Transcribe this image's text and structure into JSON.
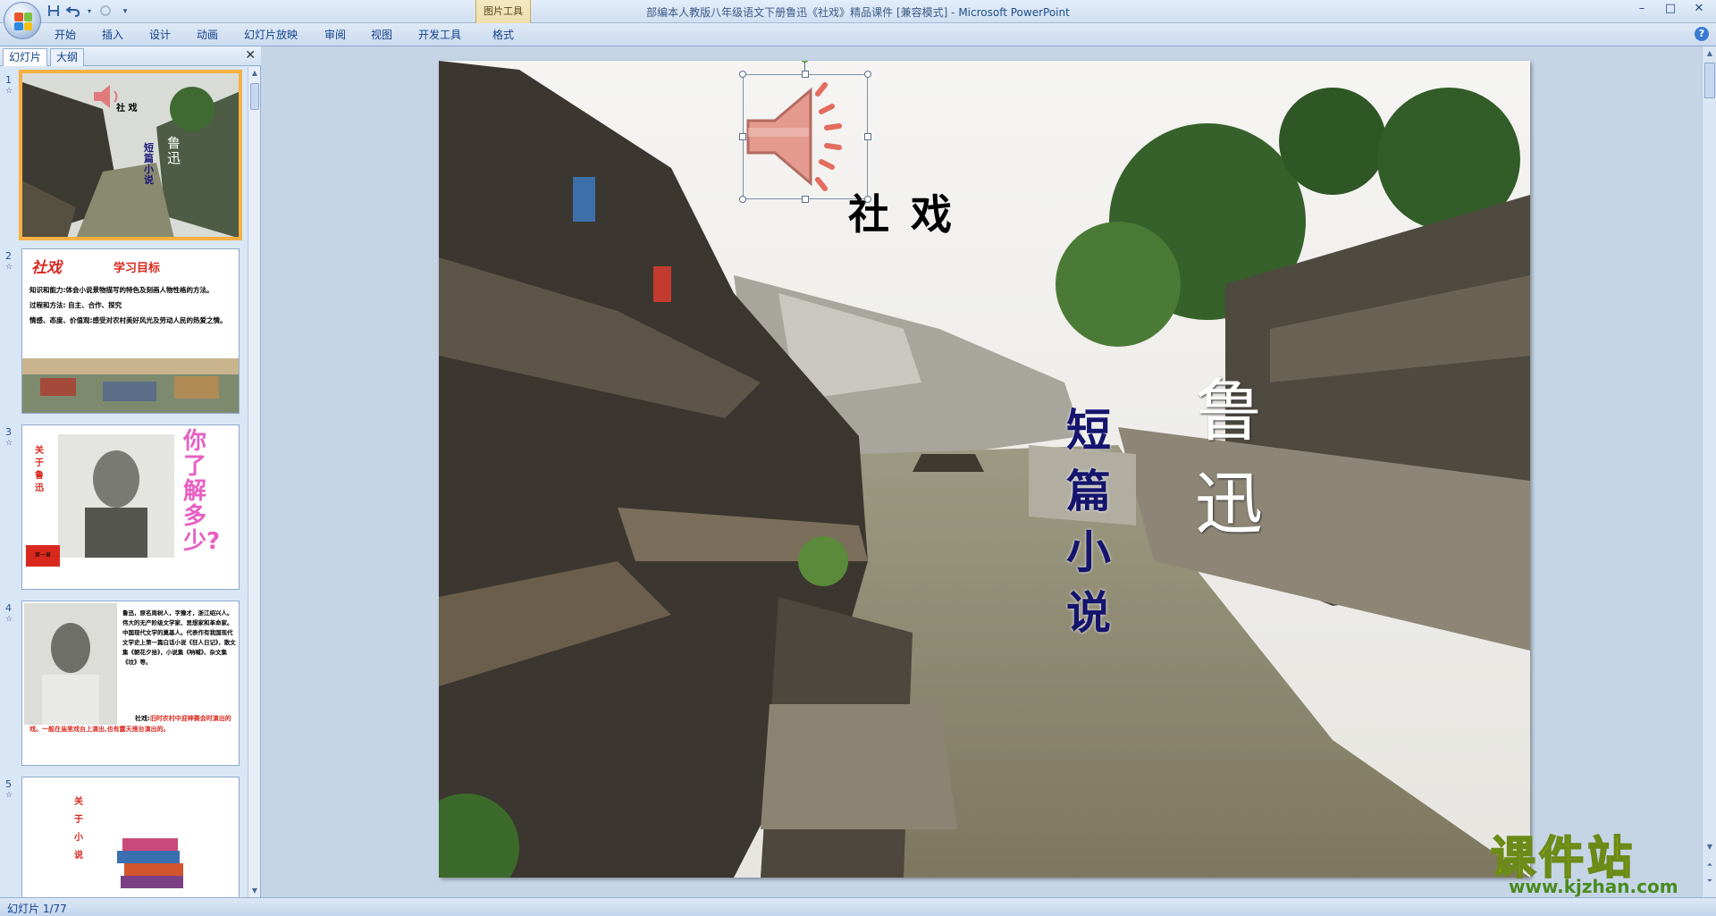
{
  "window": {
    "title_prefix": "部编本人教版八年级语文下册鲁迅《社戏》精品课件 [兼容模式] - ",
    "app_name": "Microsoft PowerPoint",
    "minimize": "–",
    "maximize": "□",
    "close": "✕"
  },
  "quick_access": {
    "save_icon": "save-icon",
    "undo_icon": "undo-icon",
    "redo_icon": "redo-icon",
    "customize_icon": "dropdown-icon"
  },
  "context_tab_group": "图片工具",
  "ribbon_tabs": [
    {
      "label": "开始"
    },
    {
      "label": "插入"
    },
    {
      "label": "设计"
    },
    {
      "label": "动画"
    },
    {
      "label": "幻灯片放映"
    },
    {
      "label": "审阅"
    },
    {
      "label": "视图"
    },
    {
      "label": "开发工具"
    },
    {
      "label": "格式"
    }
  ],
  "help": "?",
  "left_pane": {
    "tabs": [
      {
        "label": "幻灯片"
      },
      {
        "label": "大纲"
      }
    ],
    "close": "✕",
    "slides": [
      {
        "num": "1"
      },
      {
        "num": "2"
      },
      {
        "num": "3"
      },
      {
        "num": "4"
      },
      {
        "num": "5"
      }
    ]
  },
  "thumb1": {
    "title": "社  戏",
    "author": "鲁迅",
    "genre": "短篇小说"
  },
  "thumb2": {
    "badge": "社戏",
    "heading": "学习目标",
    "items": [
      "知识和能力:体会小说景物描写的特色及刻画人物性格的方法。",
      "过程和方法: 自主、合作、探究",
      "情感、态度、价值观:感受对农村美好风光及劳动人民的热爱之情。"
    ]
  },
  "thumb3": {
    "side": "关于鲁迅",
    "big": "你了解多少?",
    "flag": "第一章"
  },
  "thumb4": {
    "bio": "鲁迅，原名周树人，字豫才，浙江绍兴人。伟大的无产阶级文学家、思想家和革命家。中国现代文学的奠基人。代表作有我国现代文学史上第一篇白话小说《狂人日记》，散文集《朝花夕拾》，小说集《呐喊》、杂文集《坟》等。",
    "term": "社戏:",
    "def": "旧时农村中迎神赛会时演出的戏。一般在庙里戏台上演出,也有露天搭台演出的。"
  },
  "thumb5": {
    "side": "关于小说"
  },
  "slide": {
    "title": "社 戏",
    "author": "鲁迅",
    "genre": "短篇小说"
  },
  "status": {
    "text": "幻灯片 1/77"
  },
  "watermark": {
    "brand": "课件站",
    "url": "www.kjzhan.com"
  }
}
